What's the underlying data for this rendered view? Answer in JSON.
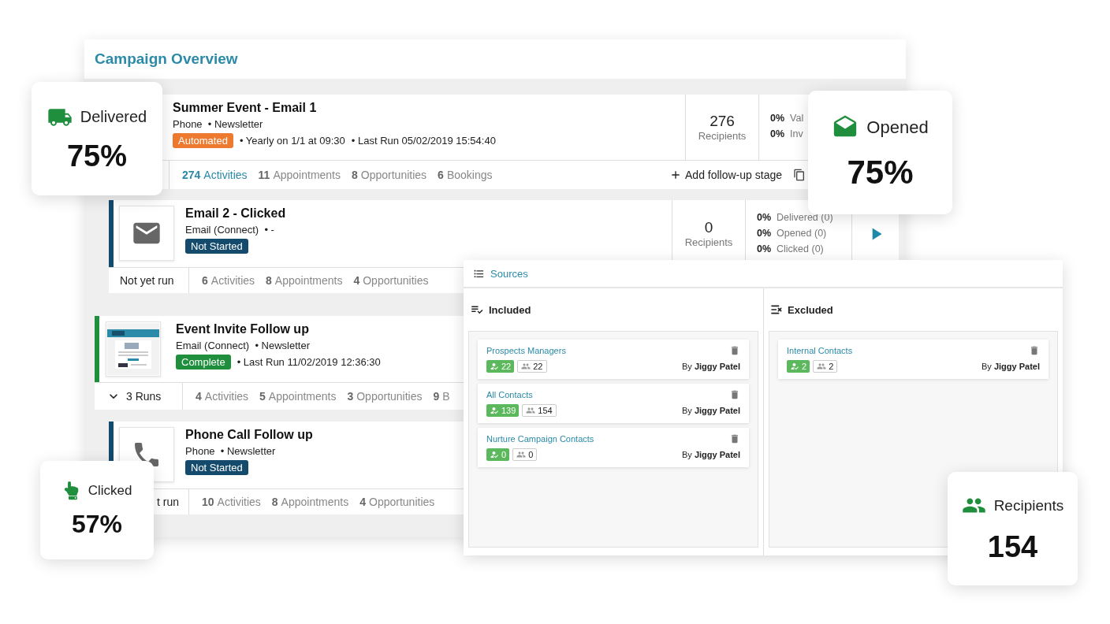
{
  "window": {
    "title": "Campaign Overview"
  },
  "stages": [
    {
      "title": "Summer Event - Email 1",
      "meta": "Phone  • Newsletter",
      "status": {
        "label": "Automated",
        "kind": "automated"
      },
      "details": [
        "• Yearly on 1/1 at 09:30",
        "• Last Run 05/02/2019 15:54:40"
      ],
      "recipients": "276",
      "recipients_label": "Recipients",
      "stats": [
        "**0%**  Val",
        "**0%**  Inv"
      ],
      "counts": [
        {
          "number": "274",
          "label": "Activities",
          "active": true
        },
        {
          "number": "11",
          "label": "Appointments",
          "active": false
        },
        {
          "number": "8",
          "label": "Opportunities",
          "active": false
        },
        {
          "number": "6",
          "label": "Bookings",
          "active": false
        }
      ],
      "follow_up": "Add follow-up stage"
    },
    {
      "title": "Email 2 - Clicked",
      "meta": "Email (Connect)  • -",
      "thumbnail": {
        "kind": "email"
      },
      "status": {
        "label": "Not Started",
        "kind": "not_started"
      },
      "recipients": "0",
      "recipients_label": "Recipients",
      "stats": [
        "**0%**  Delivered (0)",
        "**0%**  Opened (0)",
        "**0%**  Clicked (0)"
      ],
      "play": true,
      "footer": {
        "kind": "plain",
        "label": "Not yet run"
      },
      "counts": [
        {
          "number": "6",
          "label": "Activities",
          "active": false
        },
        {
          "number": "8",
          "label": "Appointments",
          "active": false
        },
        {
          "number": "4",
          "label": "Opportunities",
          "active": false
        }
      ]
    },
    {
      "title": "Event Invite Follow up",
      "meta": "Email (Connect)  • Newsletter",
      "thumbnail": {
        "kind": "preview"
      },
      "status": {
        "label": "Complete",
        "kind": "complete"
      },
      "details": [
        "• Last Run 11/02/2019 12:36:30"
      ],
      "footer": {
        "kind": "runs",
        "label": "3 Runs"
      },
      "counts": [
        {
          "number": "4",
          "label": "Activities",
          "active": false
        },
        {
          "number": "5",
          "label": "Appointments",
          "active": false
        },
        {
          "number": "3",
          "label": "Opportunities",
          "active": false
        },
        {
          "number": "9",
          "label": "B",
          "active": false
        }
      ]
    },
    {
      "title": "Phone Call Follow up",
      "meta": "Phone  • Newsletter",
      "thumbnail": {
        "kind": "phone"
      },
      "status": {
        "label": "Not Started",
        "kind": "not_started"
      },
      "footer": {
        "kind": "plain",
        "label": "t run"
      },
      "counts": [
        {
          "number": "10",
          "label": "Activities",
          "active": false
        },
        {
          "number": "8",
          "label": "Appointments",
          "active": false
        },
        {
          "number": "4",
          "label": "Opportunities",
          "active": false
        }
      ]
    }
  ],
  "sources": {
    "tab": "Sources",
    "columns": [
      {
        "kind": "included",
        "title": "Included",
        "items": [
          {
            "name": "Prospects Managers",
            "valid": "22",
            "total": "22",
            "owner": "By **Jiggy Patel**"
          },
          {
            "name": "All Contacts",
            "valid": "139",
            "total": "154",
            "owner": "By **Jiggy Patel**"
          },
          {
            "name": "Nurture Campaign Contacts",
            "valid": "0",
            "total": "0",
            "owner": "By **Jiggy Patel**"
          }
        ]
      },
      {
        "kind": "excluded",
        "title": "Excluded",
        "items": [
          {
            "name": "Internal Contacts",
            "valid": "2",
            "total": "2",
            "owner": "By **Jiggy Patel**"
          }
        ]
      }
    ]
  },
  "highlights": [
    {
      "kind": "delivered",
      "label": "Delivered",
      "value": "75%"
    },
    {
      "kind": "opened",
      "label": "Opened",
      "value": "75%"
    },
    {
      "kind": "clicked",
      "label": "Clicked",
      "value": "57%"
    },
    {
      "kind": "recipients",
      "label": "Recipients",
      "value": "154"
    }
  ]
}
